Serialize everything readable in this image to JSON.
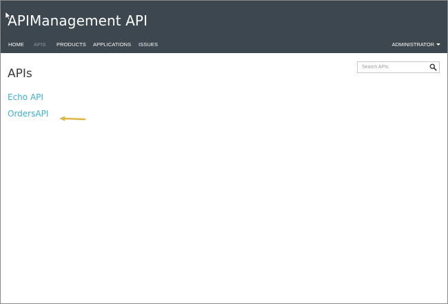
{
  "header": {
    "brand": "APIManagement API",
    "nav": [
      {
        "label": "HOME",
        "active": false
      },
      {
        "label": "APIS",
        "active": true
      },
      {
        "label": "PRODUCTS",
        "active": false
      },
      {
        "label": "APPLICATIONS",
        "active": false
      },
      {
        "label": "ISSUES",
        "active": false
      }
    ],
    "user_menu": "ADMINISTRATOR"
  },
  "main": {
    "title": "APIs",
    "search": {
      "placeholder": "Search APIs",
      "value": ""
    },
    "apis": [
      {
        "label": "Echo API"
      },
      {
        "label": "OrdersAPI"
      }
    ]
  },
  "colors": {
    "header_bg": "#3d4750",
    "link": "#3bb0d6",
    "annotation_arrow": "#e1b448"
  },
  "icons": [
    "mouse-pointer-icon",
    "search-icon",
    "caret-down-icon",
    "annotation-arrow-icon"
  ]
}
